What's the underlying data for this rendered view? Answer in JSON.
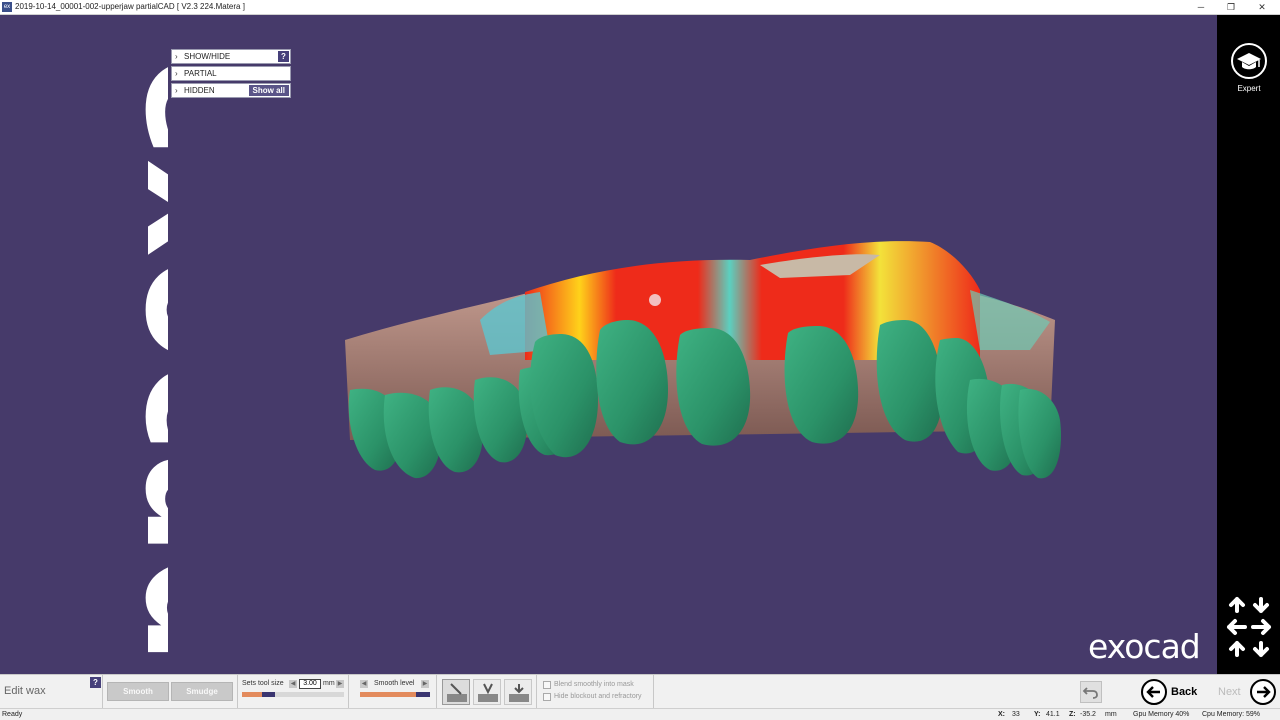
{
  "window": {
    "title": "2019-10-14_00001-002-upperjaw partialCAD [ V2.3 224.Matera ]",
    "icon": "exocad-app-icon",
    "controls": [
      "─",
      "❐",
      "✕"
    ]
  },
  "brand": {
    "logo_text": "exocad"
  },
  "panel": {
    "items": [
      {
        "label": "SHOW/HIDE",
        "help": "?"
      },
      {
        "label": "PARTIAL"
      },
      {
        "label": "HIDDEN",
        "action": "Show all"
      }
    ]
  },
  "sidebar": {
    "expert_label": "Expert"
  },
  "toolbar": {
    "edit_wax_label": "Edit wax",
    "help": "?",
    "smooth_label": "Smooth",
    "smudge_label": "Smudge",
    "tool_size_label": "Sets tool size",
    "tool_size_value": "3.00",
    "tool_size_unit": "mm",
    "smooth_level_label": "Smooth level",
    "blend_label": "Blend smoothly into mask",
    "hide_blockout_label": "Hide blockout and refractory",
    "back_label": "Back",
    "next_label": "Next"
  },
  "status": {
    "ready": "Ready",
    "x_label": "X:",
    "x_value": "33",
    "y_label": "Y:",
    "y_value": "41.1",
    "z_label": "Z:",
    "z_value": "-35.2",
    "unit": "mm",
    "gpu_memory": "Gpu Memory 40%",
    "cpu_memory": "Cpu Memory: 59%"
  },
  "colors": {
    "background": "#463a6a",
    "teeth": "#2e9a6e",
    "gum": "#a97d74",
    "heatmap_red": "#ee2b1a",
    "accent": "#46407a"
  }
}
